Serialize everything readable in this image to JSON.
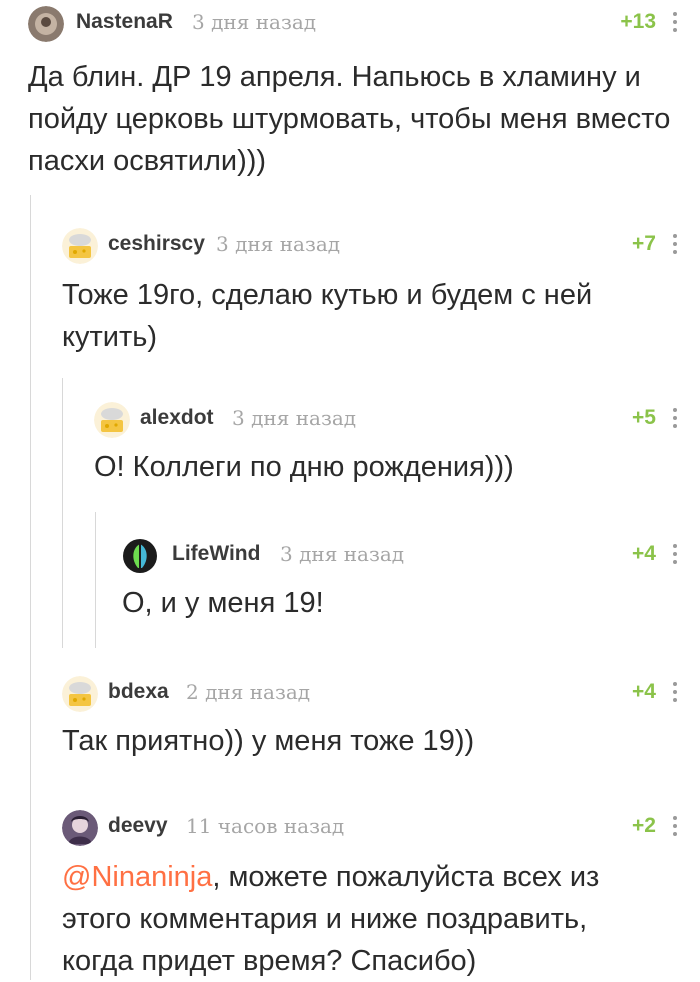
{
  "comments": [
    {
      "author": "NastenaR",
      "time": "3 дня назад",
      "rating": "+13",
      "text": "Да блин. ДР 19 апреля. Напьюсь в хламину и пойду церковь штурмовать, чтобы меня вместо пасхи освятили)))"
    },
    {
      "author": "ceshirscy",
      "time": "3 дня назад",
      "rating": "+7",
      "text": "Тоже 19го, сделаю кутью и будем с ней кутить)"
    },
    {
      "author": "alexdot",
      "time": "3 дня назад",
      "rating": "+5",
      "text": "О! Коллеги по дню рождения)))"
    },
    {
      "author": "LifeWind",
      "time": "3 дня назад",
      "rating": "+4",
      "text": "О, и у меня 19!"
    },
    {
      "author": "bdexa",
      "time": "2 дня назад",
      "rating": "+4",
      "text": "Так приятно)) у меня тоже 19))"
    },
    {
      "author": "deevy",
      "time": "11 часов назад",
      "rating": "+2",
      "mention": "@Ninaninja",
      "text": ", можете пожалуйста всех из этого комментария и ниже поздравить, когда придет время? Спасибо)"
    }
  ],
  "colors": {
    "rating": "#8bc34a",
    "mention": "#ff7043",
    "muted": "#a6a6a6",
    "thread_line": "#d8d8d8"
  }
}
